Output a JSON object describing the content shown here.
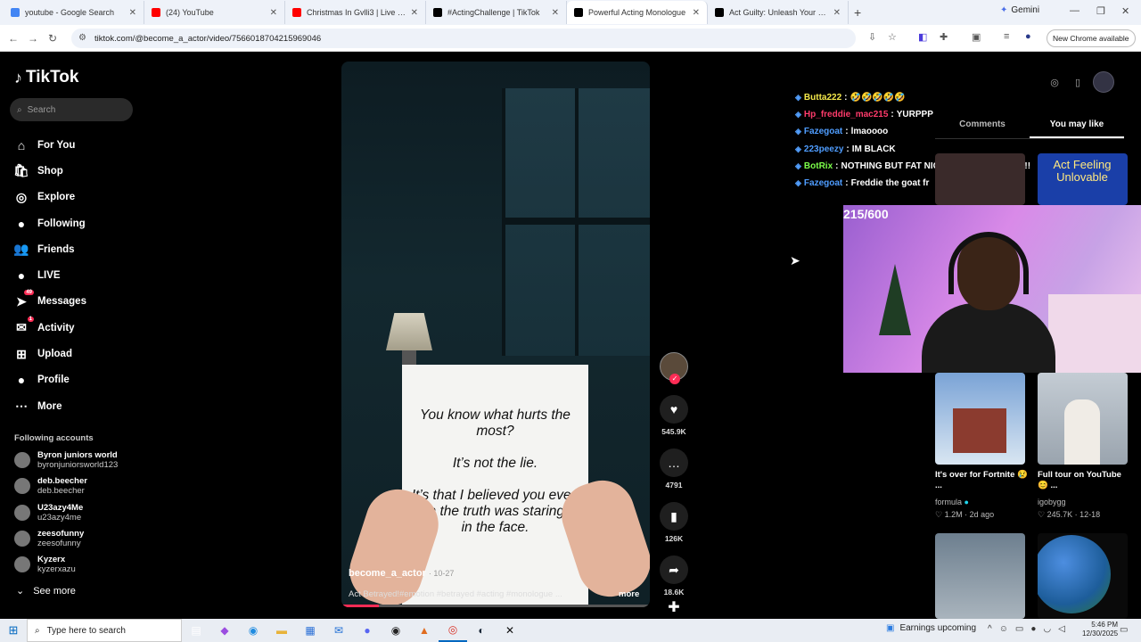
{
  "browser": {
    "tabs": [
      {
        "title": "youtube - Google Search",
        "icon": "google-icon",
        "color": "#4285f4",
        "active": false
      },
      {
        "title": "(24) YouTube",
        "icon": "youtube-icon",
        "color": "#ff0000",
        "active": false
      },
      {
        "title": "Christmas In Gvlli3 | Live Freest",
        "icon": "youtube-icon",
        "color": "#ff0000",
        "active": false
      },
      {
        "title": "#ActingChallenge | TikTok",
        "icon": "tiktok-icon",
        "color": "#000000",
        "active": false
      },
      {
        "title": "Powerful Acting Monologue",
        "icon": "tiktok-icon",
        "color": "#000000",
        "active": true
      },
      {
        "title": "Act Guilty: Unleash Your Emoti",
        "icon": "tiktok-icon",
        "color": "#000000",
        "active": false
      }
    ],
    "gemini_label": "Gemini",
    "url": "tiktok.com/@become_a_actor/video/7566018704215969046",
    "new_chrome_label": "New Chrome available"
  },
  "sidebar": {
    "brand": "TikTok",
    "search_placeholder": "Search",
    "nav": [
      {
        "label": "For You",
        "icon": "home-icon",
        "glyph": "⌂"
      },
      {
        "label": "Shop",
        "icon": "shop-icon",
        "glyph": "🛍"
      },
      {
        "label": "Explore",
        "icon": "compass-icon",
        "glyph": "◎"
      },
      {
        "label": "Following",
        "icon": "following-avatar-icon",
        "glyph": "●"
      },
      {
        "label": "Friends",
        "icon": "friends-icon",
        "glyph": "👥"
      },
      {
        "label": "LIVE",
        "icon": "live-icon",
        "glyph": "●"
      },
      {
        "label": "Messages",
        "icon": "messages-icon",
        "glyph": "➤",
        "badge": "49"
      },
      {
        "label": "Activity",
        "icon": "activity-icon",
        "glyph": "✉",
        "badge": "1"
      },
      {
        "label": "Upload",
        "icon": "upload-icon",
        "glyph": "⊞"
      },
      {
        "label": "Profile",
        "icon": "profile-icon",
        "glyph": "●"
      },
      {
        "label": "More",
        "icon": "more-icon",
        "glyph": "⋯"
      }
    ],
    "following_title": "Following accounts",
    "following": [
      {
        "name": "Byron juniors world",
        "handle": "byronjuniorsworld123"
      },
      {
        "name": "deb.beecher",
        "handle": "deb.beecher"
      },
      {
        "name": "U23azy4Me",
        "handle": "u23azy4me"
      },
      {
        "name": "zeesofunny",
        "handle": "zeesofunny"
      },
      {
        "name": "Kyzerx",
        "handle": "kyzerxazu"
      }
    ],
    "see_more": "See more"
  },
  "video": {
    "paper_lines": [
      "You know what hurts the most?",
      "It’s not the lie.",
      "It’s that I believed you even when the truth was staring me in the face."
    ],
    "username": "become_a_actor",
    "date": "· 10-27",
    "caption": "Act Betrayed!#emotion #betrayed #acting #monologue ...",
    "more": "more",
    "progress": 0.12
  },
  "actions": {
    "likes": "545.9K",
    "comments": "4791",
    "saves": "126K",
    "shares": "18.6K"
  },
  "chat": [
    {
      "user": "Butta222",
      "msg": "🤣🤣🤣🤣🤣",
      "color": "#f5e94b"
    },
    {
      "user": "Hp_freddie_mac215",
      "msg": "YURPPP",
      "color": "#ff3b6b"
    },
    {
      "user": "Fazegoat",
      "msg": "lmaoooo",
      "color": "#4f9dff"
    },
    {
      "user": "223peezy",
      "msg": "IM BLACK",
      "color": "#4f9dff"
    },
    {
      "user": "BotRix",
      "msg": "NOTHING BUT FAT NIGGAS IN THIS JAWN!!!",
      "color": "#7cff4a"
    },
    {
      "user": "Fazegoat",
      "msg": "Freddie the goat fr",
      "color": "#4f9dff"
    }
  ],
  "right_panel": {
    "tab_comments": "Comments",
    "tab_you_may_like": "You may like",
    "cards": [
      {
        "title": "Act Feeling Unlovable",
        "bg": "#1a3fa8"
      },
      {
        "title": "It's over for Fortnite 😢 ...",
        "author": "formula",
        "views": "1.2M",
        "date": "· 2d ago",
        "bg": "#4a7ab0"
      },
      {
        "title": "Full tour on YouTube 😊 ...",
        "author": "igobygg",
        "views": "245.7K",
        "date": "· 12-18",
        "bg": "#b8c4d0"
      }
    ]
  },
  "webcam": {
    "counter": "215/600"
  },
  "taskbar": {
    "search_placeholder": "Type here to search",
    "news": "Earnings upcoming",
    "time": "5:46 PM",
    "date": "12/30/2025"
  }
}
